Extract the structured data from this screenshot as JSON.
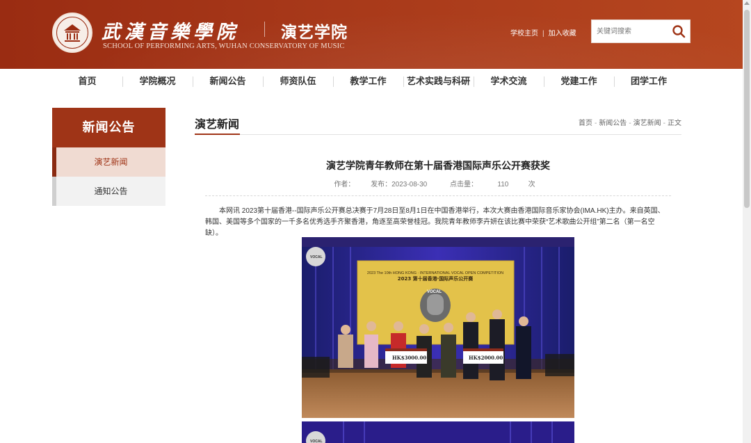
{
  "header": {
    "school_name_cn": "武漢音樂學院",
    "dept_name_cn": "演艺学院",
    "school_name_en": "SCHOOL OF PERFORMING ARTS, WUHAN CONSERVATORY OF MUSIC",
    "links": [
      "学校主页",
      "加入收藏"
    ],
    "search_placeholder": "关键词搜索"
  },
  "nav": {
    "items": [
      "首页",
      "学院概况",
      "新闻公告",
      "师资队伍",
      "教学工作",
      "艺术实践与科研",
      "学术交流",
      "党建工作",
      "团学工作"
    ]
  },
  "sidebar": {
    "title": "新闻公告",
    "items": [
      {
        "label": "演艺新闻",
        "active": true
      },
      {
        "label": "通知公告",
        "active": false
      }
    ]
  },
  "main": {
    "section_title": "演艺新闻",
    "breadcrumb": [
      "首页",
      "新闻公告",
      "演艺新闻",
      "正文"
    ],
    "article": {
      "title": "演艺学院青年教师在第十届香港国际声乐公开赛获奖",
      "author_label": "作者：",
      "date_label": "发布：2023-08-30",
      "views_label": "点击量：",
      "views": "110",
      "views_unit": "次",
      "body": "本网讯 2023第十届香港--国际声乐公开赛总决赛于7月28日至8月1日在中国香港举行，本次大赛由香港国际音乐家协会(IMA.HK)主办。来自英国、韩国、美国等多个国家的一千多名优秀选手齐聚香港，角逐至高荣誉桂冠。我院青年教师李卉妍在该比赛中荣获“艺术歌曲公开组”第二名（第一名空缺）。"
    },
    "photo": {
      "banner_line1": "2023 The 10th HONG KONG · INTERNATIONAL VOCAL OPEN COMPETITION",
      "banner_line2": "2023 第十届香港·国际声乐公开赛",
      "logo_text": "VOCAL",
      "cheque1": "HK$3000.00",
      "cheque2": "HK$2000.00"
    }
  },
  "colors": {
    "brand": "#9f3417",
    "header_bg": "#a8391a"
  }
}
